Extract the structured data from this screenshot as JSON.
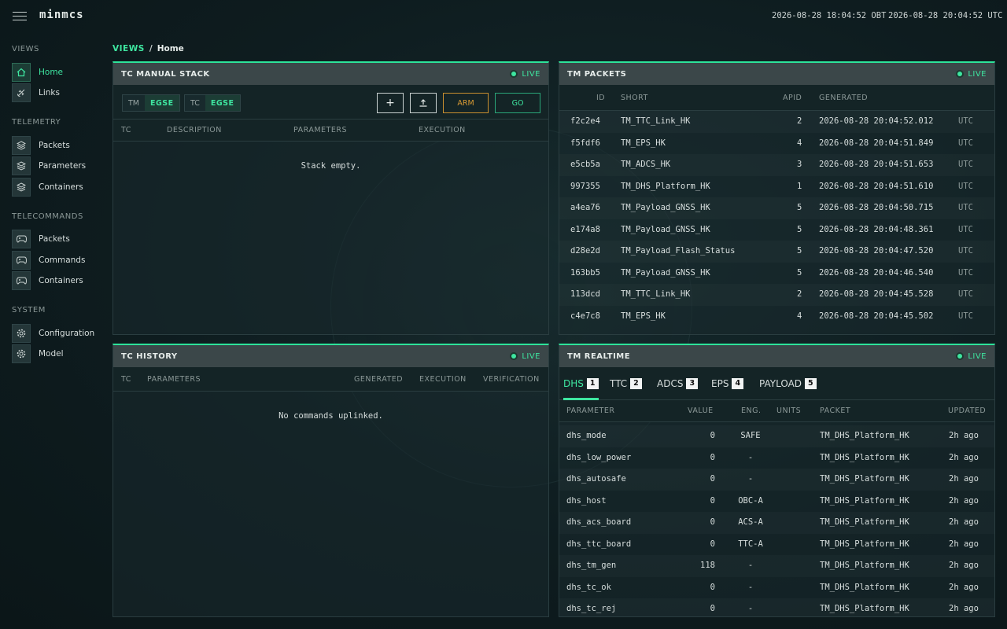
{
  "app": {
    "logo": "minmcs"
  },
  "clocks": {
    "obt": "2026-08-28 18:04:52 OBT",
    "utc": "2026-08-28 20:04:52 UTC"
  },
  "sidebar": {
    "sections": [
      {
        "title": "VIEWS",
        "items": [
          {
            "label": "Home",
            "icon": "home-icon"
          },
          {
            "label": "Links",
            "icon": "satellite-icon"
          }
        ]
      },
      {
        "title": "TELEMETRY",
        "items": [
          {
            "label": "Packets",
            "icon": "layers-icon"
          },
          {
            "label": "Parameters",
            "icon": "layers-icon"
          },
          {
            "label": "Containers",
            "icon": "layers-icon"
          }
        ]
      },
      {
        "title": "TELECOMMANDS",
        "items": [
          {
            "label": "Packets",
            "icon": "gamepad-icon"
          },
          {
            "label": "Commands",
            "icon": "gamepad-icon"
          },
          {
            "label": "Containers",
            "icon": "gamepad-icon"
          }
        ]
      },
      {
        "title": "SYSTEM",
        "items": [
          {
            "label": "Configuration",
            "icon": "gear-icon"
          },
          {
            "label": "Model",
            "icon": "gear-icon"
          }
        ]
      }
    ]
  },
  "breadcrumb": {
    "root": "VIEWS",
    "sep": "/",
    "page": "Home"
  },
  "live_label": "LIVE",
  "tc_stack": {
    "title": "TC MANUAL STACK",
    "tm_key": "TM",
    "tm_val": "EGSE",
    "tc_key": "TC",
    "tc_val": "EGSE",
    "add": "+",
    "arm": "ARM",
    "go": "GO",
    "columns": [
      "TC",
      "DESCRIPTION",
      "PARAMETERS",
      "EXECUTION"
    ],
    "empty": "Stack empty."
  },
  "tc_history": {
    "title": "TC HISTORY",
    "columns": [
      "TC",
      "PARAMETERS",
      "GENERATED",
      "EXECUTION",
      "VERIFICATION"
    ],
    "empty": "No commands uplinked."
  },
  "tm_packets": {
    "title": "TM PACKETS",
    "columns": [
      "ID",
      "SHORT",
      "APID",
      "GENERATED"
    ],
    "rows": [
      {
        "id": "f2c2e4",
        "short": "TM_TTC_Link_HK",
        "apid": "2",
        "gen": "2026-08-28 20:04:52.012",
        "tz": "UTC"
      },
      {
        "id": "f5fdf6",
        "short": "TM_EPS_HK",
        "apid": "4",
        "gen": "2026-08-28 20:04:51.849",
        "tz": "UTC"
      },
      {
        "id": "e5cb5a",
        "short": "TM_ADCS_HK",
        "apid": "3",
        "gen": "2026-08-28 20:04:51.653",
        "tz": "UTC"
      },
      {
        "id": "997355",
        "short": "TM_DHS_Platform_HK",
        "apid": "1",
        "gen": "2026-08-28 20:04:51.610",
        "tz": "UTC"
      },
      {
        "id": "a4ea76",
        "short": "TM_Payload_GNSS_HK",
        "apid": "5",
        "gen": "2026-08-28 20:04:50.715",
        "tz": "UTC"
      },
      {
        "id": "e174a8",
        "short": "TM_Payload_GNSS_HK",
        "apid": "5",
        "gen": "2026-08-28 20:04:48.361",
        "tz": "UTC"
      },
      {
        "id": "d28e2d",
        "short": "TM_Payload_Flash_Status",
        "apid": "5",
        "gen": "2026-08-28 20:04:47.520",
        "tz": "UTC"
      },
      {
        "id": "163bb5",
        "short": "TM_Payload_GNSS_HK",
        "apid": "5",
        "gen": "2026-08-28 20:04:46.540",
        "tz": "UTC"
      },
      {
        "id": "113dcd",
        "short": "TM_TTC_Link_HK",
        "apid": "2",
        "gen": "2026-08-28 20:04:45.528",
        "tz": "UTC"
      },
      {
        "id": "c4e7c8",
        "short": "TM_EPS_HK",
        "apid": "4",
        "gen": "2026-08-28 20:04:45.502",
        "tz": "UTC"
      }
    ]
  },
  "tm_realtime": {
    "title": "TM REALTIME",
    "tabs": [
      {
        "label": "DHS",
        "badge": "1"
      },
      {
        "label": "TTC",
        "badge": "2"
      },
      {
        "label": "ADCS",
        "badge": "3"
      },
      {
        "label": "EPS",
        "badge": "4"
      },
      {
        "label": "PAYLOAD",
        "badge": "5"
      }
    ],
    "columns": [
      "PARAMETER",
      "VALUE",
      "ENG.",
      "UNITS",
      "PACKET",
      "UPDATED"
    ],
    "rows": [
      {
        "param": "dhs_mode",
        "value": "0",
        "eng": "SAFE",
        "units": "",
        "packet": "TM_DHS_Platform_HK",
        "updated": "2h ago"
      },
      {
        "param": "dhs_low_power",
        "value": "0",
        "eng": "-",
        "units": "",
        "packet": "TM_DHS_Platform_HK",
        "updated": "2h ago"
      },
      {
        "param": "dhs_autosafe",
        "value": "0",
        "eng": "-",
        "units": "",
        "packet": "TM_DHS_Platform_HK",
        "updated": "2h ago"
      },
      {
        "param": "dhs_host",
        "value": "0",
        "eng": "OBC-A",
        "units": "",
        "packet": "TM_DHS_Platform_HK",
        "updated": "2h ago"
      },
      {
        "param": "dhs_acs_board",
        "value": "0",
        "eng": "ACS-A",
        "units": "",
        "packet": "TM_DHS_Platform_HK",
        "updated": "2h ago"
      },
      {
        "param": "dhs_ttc_board",
        "value": "0",
        "eng": "TTC-A",
        "units": "",
        "packet": "TM_DHS_Platform_HK",
        "updated": "2h ago"
      },
      {
        "param": "dhs_tm_gen",
        "value": "118",
        "eng": "-",
        "units": "",
        "packet": "TM_DHS_Platform_HK",
        "updated": "2h ago"
      },
      {
        "param": "dhs_tc_ok",
        "value": "0",
        "eng": "-",
        "units": "",
        "packet": "TM_DHS_Platform_HK",
        "updated": "2h ago"
      },
      {
        "param": "dhs_tc_rej",
        "value": "0",
        "eng": "-",
        "units": "",
        "packet": "TM_DHS_Platform_HK",
        "updated": "2h ago"
      }
    ]
  }
}
